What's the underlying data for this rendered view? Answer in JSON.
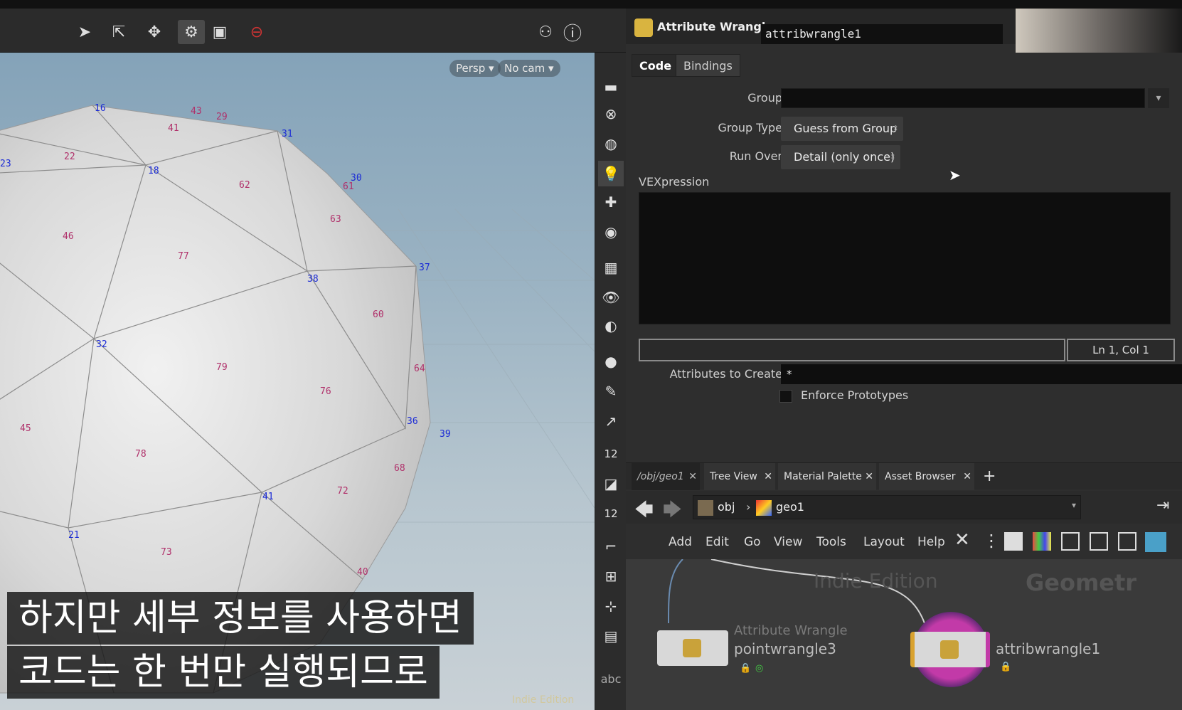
{
  "viewport": {
    "view_label": "Persp",
    "cam_label": "No cam",
    "watermark": "Indie Edition",
    "abc": "abc",
    "point_labels": [
      "16",
      "18",
      "31",
      "30",
      "37",
      "38",
      "32",
      "36",
      "39",
      "41",
      "21",
      "23"
    ],
    "prim_labels": [
      "43",
      "29",
      "41",
      "22",
      "62",
      "61",
      "63",
      "46",
      "77",
      "60",
      "79",
      "64",
      "76",
      "45",
      "78",
      "68",
      "72",
      "73",
      "40"
    ],
    "shelf_badges": [
      "12",
      "12"
    ]
  },
  "parameters": {
    "node_type": "Attribute Wrangle",
    "node_name": "attribwrangle1",
    "tabs": [
      "Code",
      "Bindings"
    ],
    "group_label": "Group",
    "group_value": "",
    "group_type_label": "Group Type",
    "group_type_value": "Guess from Group",
    "run_over_label": "Run Over",
    "run_over_value": "Detail (only once)",
    "vexpression_label": "VEXpression",
    "vexpression_value": "",
    "cursor_pos": "Ln 1, Col 1",
    "attributes_to_create_label": "Attributes to Create",
    "attributes_to_create_value": "*",
    "enforce_prototypes_label": "Enforce Prototypes",
    "enforce_prototypes_checked": false
  },
  "network": {
    "tabs": [
      "/obj/geo1",
      "Tree View",
      "Material Palette",
      "Asset Browser"
    ],
    "path": [
      "obj",
      "geo1"
    ],
    "menu": [
      "Add",
      "Edit",
      "Go",
      "View",
      "Tools",
      "Layout",
      "Help"
    ],
    "watermark_left": "Indie Edition",
    "watermark_right": "Geometr",
    "nodes": [
      {
        "type_label": "Attribute Wrangle",
        "name": "pointwrangle3"
      },
      {
        "type_label": "",
        "name": "attribwrangle1"
      }
    ]
  },
  "subtitles": {
    "line1": "하지만 세부 정보를 사용하면",
    "line2": "코드는 한 번만 실행되므로"
  },
  "colors": {
    "point_label": "#1a2ad6",
    "prim_label": "#b0306a",
    "selected_node_ring": "#c23aa8"
  }
}
